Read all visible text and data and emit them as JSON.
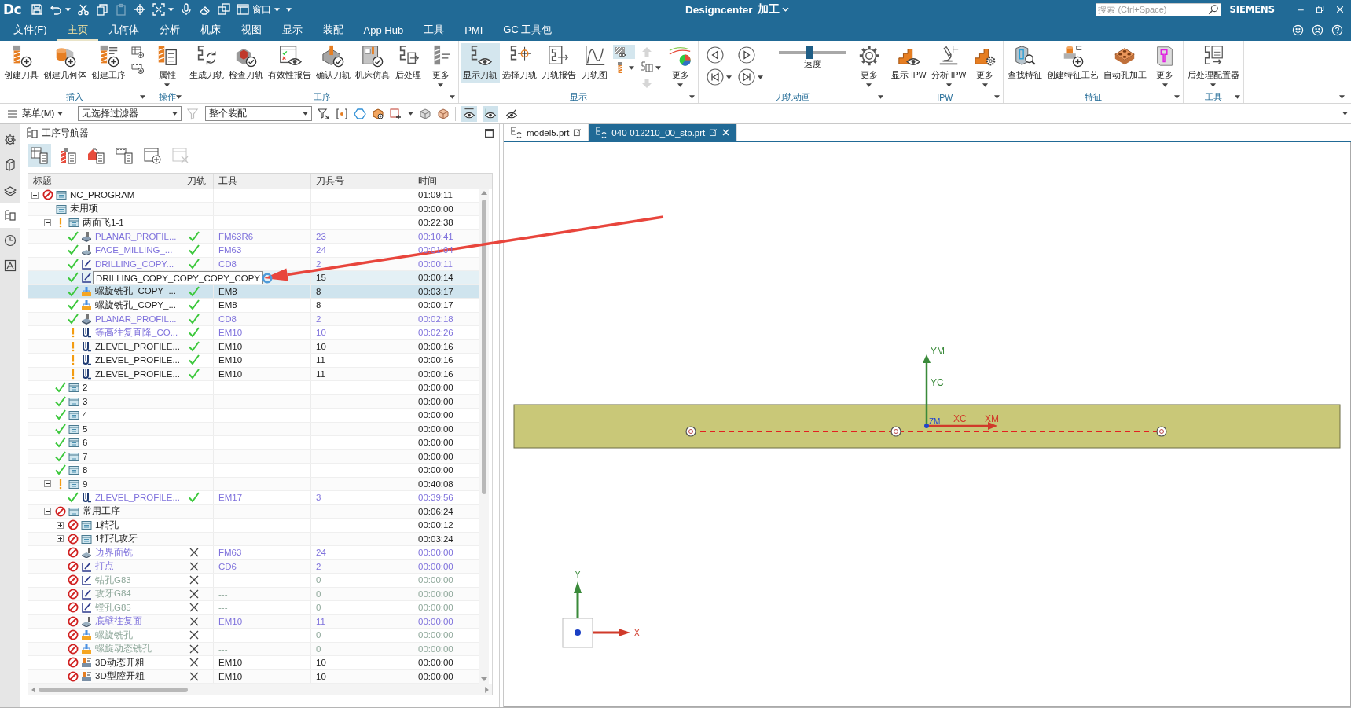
{
  "title_bar": {
    "logo": "Dc",
    "window_menu": "窗口",
    "title": "Designcenter",
    "app_menu": "加工",
    "search": {
      "placeholder": "搜索 (Ctrl+Space)"
    },
    "brand": "SIEMENS"
  },
  "quick_access": [
    {
      "disabled": false
    },
    {
      "disabled": false
    },
    {
      "disabled": false
    },
    {
      "disabled": false
    },
    {
      "disabled": true
    },
    {
      "disabled": false
    },
    {
      "disabled": false
    },
    {
      "disabled": false
    },
    {
      "disabled": false
    },
    {
      "disabled": false
    },
    {
      "disabled": false
    }
  ],
  "menu_tabs": [
    {
      "label": "文件(F)",
      "selected": false
    },
    {
      "label": "主页",
      "selected": true
    },
    {
      "label": "几何体",
      "selected": false
    },
    {
      "label": "分析",
      "selected": false
    },
    {
      "label": "机床",
      "selected": false
    },
    {
      "label": "视图",
      "selected": false
    },
    {
      "label": "显示",
      "selected": false
    },
    {
      "label": "装配",
      "selected": false
    },
    {
      "label": "App Hub",
      "selected": false
    },
    {
      "label": "工具",
      "selected": false
    },
    {
      "label": "PMI",
      "selected": false
    },
    {
      "label": "GC 工具包",
      "selected": false
    }
  ],
  "ribbon": [
    {
      "label": "插入",
      "items": [
        {
          "kind": "large",
          "label": "创建刀具",
          "dropdown": false,
          "on": false
        },
        {
          "kind": "large",
          "label": "创建几何体",
          "dropdown": false,
          "on": false
        },
        {
          "kind": "large",
          "label": "创建工序",
          "dropdown": false,
          "on": false
        },
        {
          "kind": "stack",
          "buttons": [
            {
              "dropdown": false,
              "on": false,
              "disabled": false
            },
            {
              "dropdown": false,
              "on": false,
              "disabled": false
            }
          ]
        }
      ]
    },
    {
      "label": "操作",
      "items": [
        {
          "kind": "large",
          "label": "属性",
          "dropdown": true,
          "on": false
        }
      ]
    },
    {
      "label": "工序",
      "items": [
        {
          "kind": "large",
          "label": "生成刀轨",
          "dropdown": false,
          "on": false
        },
        {
          "kind": "large",
          "label": "检查刀轨",
          "dropdown": false,
          "on": false
        },
        {
          "kind": "large",
          "label": "有效性报告",
          "dropdown": false,
          "on": false
        },
        {
          "kind": "large",
          "label": "确认刀轨",
          "dropdown": false,
          "on": false
        },
        {
          "kind": "large",
          "label": "机床仿真",
          "dropdown": false,
          "on": false
        },
        {
          "kind": "large",
          "label": "后处理",
          "dropdown": false,
          "on": false
        },
        {
          "kind": "large",
          "label": "更多",
          "dropdown": true,
          "on": false
        }
      ]
    },
    {
      "label": "显示",
      "items": [
        {
          "kind": "large",
          "label": "显示刀轨",
          "dropdown": false,
          "on": true
        },
        {
          "kind": "large",
          "label": "选择刀轨",
          "dropdown": false,
          "on": false
        },
        {
          "kind": "large",
          "label": "刀轨报告",
          "dropdown": false,
          "on": false
        },
        {
          "kind": "large",
          "label": "刀轨图",
          "dropdown": false,
          "on": false
        },
        {
          "kind": "stack",
          "buttons": [
            {
              "dropdown": false,
              "on": true,
              "disabled": false
            },
            {
              "dropdown": true,
              "on": false,
              "disabled": false
            }
          ]
        },
        {
          "kind": "stack",
          "buttons": [
            {
              "dropdown": false,
              "on": false,
              "disabled": true
            },
            {
              "dropdown": true,
              "on": false,
              "disabled": false
            },
            {
              "dropdown": false,
              "on": false,
              "disabled": true
            }
          ]
        },
        {
          "kind": "large",
          "label": "更多",
          "dropdown": true,
          "on": false
        }
      ]
    },
    {
      "label": "刀轨动画",
      "items": [
        {
          "kind": "player",
          "buttons": [
            {
              "dropdown": false
            },
            {
              "dropdown": false
            },
            {
              "dropdown": true
            },
            {
              "dropdown": true
            }
          ]
        },
        {
          "kind": "slider",
          "label": "速度",
          "level": 0.44
        },
        {
          "kind": "large",
          "label": "更多",
          "dropdown": true,
          "on": false
        }
      ]
    },
    {
      "label": "IPW",
      "items": [
        {
          "kind": "large",
          "label": "显示 IPW",
          "dropdown": false,
          "on": false
        },
        {
          "kind": "large",
          "label": "分析 IPW",
          "dropdown": true,
          "on": false
        },
        {
          "kind": "large",
          "label": "更多",
          "dropdown": true,
          "on": false
        }
      ]
    },
    {
      "label": "特征",
      "items": [
        {
          "kind": "large",
          "label": "查找特征",
          "dropdown": false,
          "on": false
        },
        {
          "kind": "large",
          "label": "创建特征工艺",
          "dropdown": false,
          "on": false
        },
        {
          "kind": "large",
          "label": "自动孔加工",
          "dropdown": false,
          "on": false
        },
        {
          "kind": "large",
          "label": "更多",
          "dropdown": true,
          "on": false
        }
      ]
    },
    {
      "label": "工具",
      "items": [
        {
          "kind": "large",
          "label": "后处理配置器",
          "dropdown": true,
          "on": false
        }
      ]
    }
  ],
  "toolbar": {
    "menu": "菜单(M)",
    "filter": {
      "value": "无选择过滤器"
    },
    "clear_filter": {
      "disabled": true
    },
    "scope": {
      "value": "整个装配"
    },
    "view_toggles": [
      {
        "on": true
      },
      {
        "on": true
      },
      {
        "on": false
      }
    ]
  },
  "side_tabs": [
    {
      "selected": false
    },
    {
      "selected": false
    },
    {
      "selected": false
    },
    {
      "selected": true
    },
    {
      "selected": false
    },
    {
      "selected": false
    }
  ],
  "navigator": {
    "title": "工序导航器",
    "tools": [
      {
        "on": true,
        "disabled": false
      },
      {
        "on": false,
        "disabled": false
      },
      {
        "on": false,
        "disabled": false
      },
      {
        "on": false,
        "disabled": false
      },
      {
        "on": false,
        "disabled": false
      },
      {
        "on": false,
        "disabled": true
      }
    ],
    "columns": [
      "标题",
      "刀轨",
      "工具",
      "刀具号",
      "时间"
    ],
    "rows": [
      {
        "name": "NC_PROGRAM",
        "kind": "program",
        "complete": false,
        "regenerate": true,
        "repost": false,
        "expanded": true,
        "time": "01:09:11",
        "selected": false,
        "children": [
          {
            "name": "未用项",
            "kind": "group",
            "complete": false,
            "regenerate": false,
            "repost": false,
            "time": "00:00:00",
            "selected": false
          },
          {
            "name": "两面飞1-1",
            "kind": "group",
            "complete": false,
            "regenerate": false,
            "repost": true,
            "expanded": true,
            "time": "00:22:38",
            "selected": false,
            "children": [
              {
                "name": "PLANAR_PROFIL...",
                "kind": "planar_mill",
                "complete": true,
                "regenerate": false,
                "repost": false,
                "toolpath": true,
                "tool": "FM63R6",
                "tool_no": "23",
                "time": "00:10:41",
                "color": "#7f72dc",
                "selected": false
              },
              {
                "name": "FACE_MILLING_...",
                "kind": "face_mill",
                "complete": true,
                "regenerate": false,
                "repost": false,
                "toolpath": true,
                "tool": "FM63",
                "tool_no": "24",
                "time": "00:01:04",
                "color": "#7f72dc",
                "selected": false
              },
              {
                "name": "DRILLING_COPY...",
                "kind": "drill",
                "complete": true,
                "regenerate": false,
                "repost": false,
                "toolpath": true,
                "tool": "CD8",
                "tool_no": "2",
                "time": "00:00:11",
                "color": "#7f72dc",
                "selected": false
              },
              {
                "tooltip": "DRILLING_COPY_COPY_COPY_COPY",
                "kind": "drill",
                "complete": true,
                "regenerate": false,
                "repost": false,
                "tool_no": "15",
                "time": "00:00:14",
                "selected": false
              },
              {
                "name": "螺旋铣孔_COPY_...",
                "kind": "hole_mill",
                "complete": true,
                "regenerate": false,
                "repost": false,
                "toolpath": true,
                "tool": "EM8",
                "tool_no": "8",
                "time": "00:03:17",
                "selected": true
              },
              {
                "name": "螺旋铣孔_COPY_...",
                "kind": "hole_mill",
                "complete": true,
                "regenerate": false,
                "repost": false,
                "toolpath": true,
                "tool": "EM8",
                "tool_no": "8",
                "time": "00:00:17",
                "selected": false
              },
              {
                "name": "PLANAR_PROFIL...",
                "kind": "planar_mill",
                "complete": true,
                "regenerate": false,
                "repost": false,
                "toolpath": true,
                "tool": "CD8",
                "tool_no": "2",
                "time": "00:02:18",
                "color": "#7f72dc",
                "selected": false
              },
              {
                "name": "等高往复直降_CO...",
                "kind": "zlevel",
                "complete": false,
                "regenerate": false,
                "repost": true,
                "toolpath": true,
                "tool": "EM10",
                "tool_no": "10",
                "time": "00:02:26",
                "color": "#7f72dc",
                "selected": false
              },
              {
                "name": "ZLEVEL_PROFILE...",
                "kind": "zlevel",
                "complete": false,
                "regenerate": false,
                "repost": true,
                "toolpath": true,
                "tool": "EM10",
                "tool_no": "10",
                "time": "00:00:16",
                "selected": false
              },
              {
                "name": "ZLEVEL_PROFILE...",
                "kind": "zlevel",
                "complete": false,
                "regenerate": false,
                "repost": true,
                "toolpath": true,
                "tool": "EM10",
                "tool_no": "11",
                "time": "00:00:16",
                "selected": false
              },
              {
                "name": "ZLEVEL_PROFILE...",
                "kind": "zlevel",
                "complete": false,
                "regenerate": false,
                "repost": true,
                "toolpath": true,
                "tool": "EM10",
                "tool_no": "11",
                "time": "00:00:16",
                "selected": false
              }
            ]
          },
          {
            "name": "2",
            "kind": "group",
            "complete": true,
            "regenerate": false,
            "repost": false,
            "time": "00:00:00",
            "selected": false
          },
          {
            "name": "3",
            "kind": "group",
            "complete": true,
            "regenerate": false,
            "repost": false,
            "time": "00:00:00",
            "selected": false
          },
          {
            "name": "4",
            "kind": "group",
            "complete": true,
            "regenerate": false,
            "repost": false,
            "time": "00:00:00",
            "selected": false
          },
          {
            "name": "5",
            "kind": "group",
            "complete": true,
            "regenerate": false,
            "repost": false,
            "time": "00:00:00",
            "selected": false
          },
          {
            "name": "6",
            "kind": "group",
            "complete": true,
            "regenerate": false,
            "repost": false,
            "time": "00:00:00",
            "selected": false
          },
          {
            "name": "7",
            "kind": "group",
            "complete": true,
            "regenerate": false,
            "repost": false,
            "time": "00:00:00",
            "selected": false
          },
          {
            "name": "8",
            "kind": "group",
            "complete": true,
            "regenerate": false,
            "repost": false,
            "time": "00:00:00",
            "selected": false
          },
          {
            "name": "9",
            "kind": "group",
            "complete": false,
            "regenerate": false,
            "repost": true,
            "expanded": true,
            "time": "00:40:08",
            "selected": false,
            "children": [
              {
                "name": "ZLEVEL_PROFILE...",
                "kind": "zlevel",
                "complete": true,
                "regenerate": false,
                "repost": false,
                "toolpath": true,
                "tool": "EM17",
                "tool_no": "3",
                "time": "00:39:56",
                "color": "#7f72dc",
                "selected": false
              }
            ]
          },
          {
            "name": "常用工序",
            "kind": "group",
            "complete": false,
            "regenerate": true,
            "repost": false,
            "expanded": true,
            "time": "00:06:24",
            "selected": false,
            "children": [
              {
                "name": "1精孔",
                "kind": "group",
                "complete": false,
                "regenerate": true,
                "repost": false,
                "expanded": false,
                "time": "00:00:12",
                "selected": false
              },
              {
                "name": "1打孔攻牙",
                "kind": "group",
                "complete": false,
                "regenerate": true,
                "repost": false,
                "expanded": false,
                "time": "00:03:24",
                "selected": false
              },
              {
                "name": "边界面铣",
                "kind": "face_mill",
                "complete": false,
                "regenerate": true,
                "repost": false,
                "toolpath": false,
                "tool": "FM63",
                "tool_no": "24",
                "time": "00:00:00",
                "color": "#7f72dc",
                "selected": false
              },
              {
                "name": "打点",
                "kind": "drill",
                "complete": false,
                "regenerate": true,
                "repost": false,
                "toolpath": false,
                "tool": "CD6",
                "tool_no": "2",
                "time": "00:00:00",
                "color": "#7f72dc",
                "selected": false
              },
              {
                "name": "钻孔G83",
                "kind": "drill",
                "complete": false,
                "regenerate": true,
                "repost": false,
                "toolpath": false,
                "tool": "---",
                "tool_no": "0",
                "time": "00:00:00",
                "color": "#8fa89b",
                "selected": false
              },
              {
                "name": "攻牙G84",
                "kind": "drill",
                "complete": false,
                "regenerate": true,
                "repost": false,
                "toolpath": false,
                "tool": "---",
                "tool_no": "0",
                "time": "00:00:00",
                "color": "#8fa89b",
                "selected": false
              },
              {
                "name": "镗孔G85",
                "kind": "drill",
                "complete": false,
                "regenerate": true,
                "repost": false,
                "toolpath": false,
                "tool": "---",
                "tool_no": "0",
                "time": "00:00:00",
                "color": "#8fa89b",
                "selected": false
              },
              {
                "name": "底壁往复面",
                "kind": "face_mill",
                "complete": false,
                "regenerate": true,
                "repost": false,
                "toolpath": false,
                "tool": "EM10",
                "tool_no": "11",
                "time": "00:00:00",
                "color": "#7f72dc",
                "selected": false
              },
              {
                "name": "螺旋铣孔",
                "kind": "hole_mill",
                "complete": false,
                "regenerate": true,
                "repost": false,
                "toolpath": false,
                "tool": "---",
                "tool_no": "0",
                "time": "00:00:00",
                "color": "#8fa89b",
                "selected": false
              },
              {
                "name": "螺旋动态铣孔",
                "kind": "hole_mill",
                "complete": false,
                "regenerate": true,
                "repost": false,
                "toolpath": false,
                "tool": "---",
                "tool_no": "0",
                "time": "00:00:00",
                "color": "#8fa89b",
                "selected": false
              },
              {
                "name": "3D动态开粗",
                "kind": "cavity_mill",
                "complete": false,
                "regenerate": true,
                "repost": false,
                "toolpath": false,
                "tool": "EM10",
                "tool_no": "10",
                "time": "00:00:00",
                "selected": false
              },
              {
                "name": "3D型腔开粗",
                "kind": "cavity_mill",
                "complete": false,
                "regenerate": true,
                "repost": false,
                "toolpath": false,
                "tool": "EM10",
                "tool_no": "10",
                "time": "00:00:00",
                "selected": false
              }
            ]
          }
        ]
      }
    ]
  },
  "viewport": {
    "tabs": [
      {
        "label": "model5.prt",
        "selected": false
      },
      {
        "label": "040-012210_00_stp.prt",
        "selected": true
      }
    ],
    "axis_labels": {
      "ym": "YM",
      "yc": "YC",
      "xc": "XC",
      "xm": "XM",
      "zm": "ZM"
    },
    "triad": {
      "y": "Y",
      "x": "X"
    }
  }
}
